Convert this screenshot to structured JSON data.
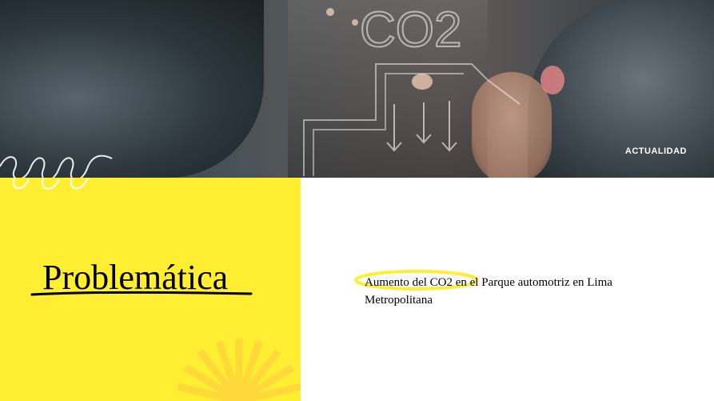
{
  "banner": {
    "section_label": "ACTUALIDAD",
    "overlay_text": "CO2"
  },
  "slide": {
    "title": "Problemática",
    "description": "Aumento del CO2 en el Parque automotriz en Lima Metropolitana"
  },
  "colors": {
    "accent_yellow": "#ffee32",
    "background": "#ffffff",
    "text": "#000000"
  }
}
